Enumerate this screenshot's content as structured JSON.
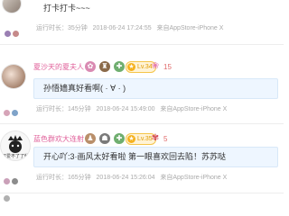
{
  "posts": [
    {
      "content": "打卡打卡~~~",
      "meta": {
        "floor": "运行时长：35分钟",
        "time": "2018-06-24 17:24:55",
        "source": "来自AppStore-iPhone X"
      }
    },
    {
      "username": "夏沙天的夏夫人",
      "level": "Lv.34",
      "likes": "15",
      "content": "孙悟嫱真好看啊( · ∀ · )",
      "meta": {
        "floor": "运行时长：145分钟",
        "time": "2018-06-24 15:49:00",
        "source": "来自AppStore-iPhone X"
      }
    },
    {
      "username": "蓝色群欢大连射",
      "level": "Lv.35",
      "likes": "5",
      "avatar_caption": "可爱不了了解",
      "content": "开心吖:3·画风太好看啦 第一眼喜欢回去陷！苏苏哒",
      "meta": {
        "floor": "运行时长：165分钟",
        "time": "2018-06-24 15:26:04",
        "source": "来自AppStore-iPhone X"
      }
    }
  ],
  "colors": {
    "username": "#e0609a",
    "bubble": "#eef6ff",
    "meta": "#aaaaaa",
    "level": "#f5b21f"
  },
  "icons": [
    "avatar",
    "badge-icon",
    "level-icon",
    "like-icon",
    "flower-icon"
  ]
}
